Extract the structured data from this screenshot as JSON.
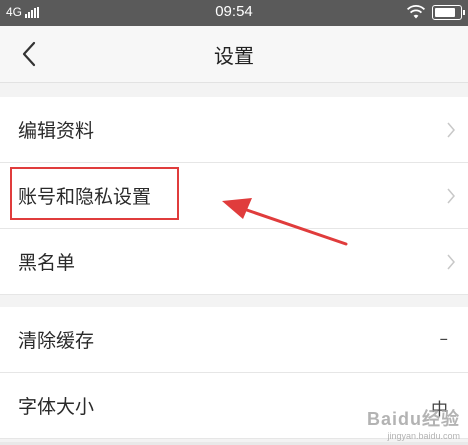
{
  "status_bar": {
    "network": "4G",
    "time": "09:54",
    "battery_level": 0.85
  },
  "header": {
    "title": "设置"
  },
  "settings_group_1": [
    {
      "label": "编辑资料"
    },
    {
      "label": "账号和隐私设置"
    },
    {
      "label": "黑名单"
    }
  ],
  "settings_group_2": [
    {
      "label": "清除缓存",
      "value": "–"
    },
    {
      "label": "字体大小",
      "value": "中"
    }
  ],
  "watermark": {
    "brand": "Baidu经验",
    "site": "jingyan.baidu.com"
  },
  "colors": {
    "annotation": "#e03c3c",
    "status_bar": "#5a5a5a"
  }
}
